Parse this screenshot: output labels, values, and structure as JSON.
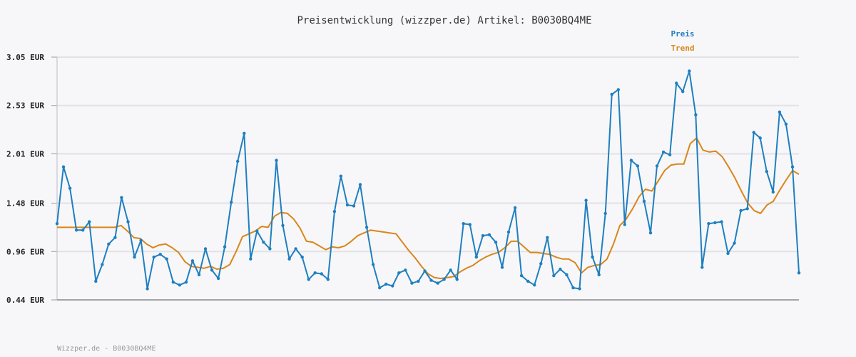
{
  "chart_data": {
    "type": "line",
    "title": "Preisentwicklung (wizzper.de) Artikel: B0030BQ4ME",
    "xlabel": "",
    "ylabel": "",
    "ylim": [
      0.44,
      3.05
    ],
    "yticks": [
      "3.05 EUR",
      "2.53 EUR",
      "2.01 EUR",
      "1.48 EUR",
      "0.96 EUR",
      "0.44 EUR"
    ],
    "ytick_values": [
      3.05,
      2.53,
      2.01,
      1.48,
      0.96,
      0.44
    ],
    "grid": true,
    "legend_position": "top-right",
    "series": [
      {
        "name": "Preis",
        "color": "#1f7fbf",
        "markers": true,
        "values": [
          1.26,
          1.87,
          1.64,
          1.19,
          1.19,
          1.28,
          0.64,
          0.82,
          1.04,
          1.11,
          1.54,
          1.28,
          0.9,
          1.08,
          0.56,
          0.9,
          0.93,
          0.88,
          0.63,
          0.6,
          0.63,
          0.86,
          0.71,
          0.99,
          0.76,
          0.67,
          1.01,
          1.49,
          1.93,
          2.23,
          0.88,
          1.18,
          1.06,
          0.99,
          1.94,
          1.24,
          0.88,
          0.99,
          0.9,
          0.66,
          0.73,
          0.72,
          0.66,
          1.39,
          1.77,
          1.46,
          1.45,
          1.68,
          1.22,
          0.82,
          0.57,
          0.61,
          0.59,
          0.73,
          0.76,
          0.62,
          0.64,
          0.75,
          0.65,
          0.62,
          0.66,
          0.76,
          0.66,
          1.26,
          1.25,
          0.9,
          1.13,
          1.14,
          1.06,
          0.79,
          1.17,
          1.43,
          0.7,
          0.64,
          0.6,
          0.83,
          1.11,
          0.7,
          0.77,
          0.71,
          0.57,
          0.56,
          1.51,
          0.9,
          0.71,
          1.37,
          2.65,
          2.7,
          1.25,
          1.94,
          1.88,
          1.5,
          1.16,
          1.88,
          2.03,
          2.0,
          2.77,
          2.68,
          2.9,
          2.43,
          0.79,
          1.26,
          1.27,
          1.28,
          0.94,
          1.05,
          1.4,
          1.42,
          2.24,
          2.18,
          1.82,
          1.6,
          2.46,
          2.33,
          1.87,
          0.73
        ]
      },
      {
        "name": "Trend",
        "color": "#d9861a",
        "markers": false,
        "values": [
          1.22,
          1.22,
          1.22,
          1.22,
          1.22,
          1.22,
          1.22,
          1.22,
          1.22,
          1.22,
          1.24,
          1.18,
          1.11,
          1.1,
          1.04,
          1.0,
          1.03,
          1.04,
          1.0,
          0.95,
          0.85,
          0.8,
          0.79,
          0.78,
          0.8,
          0.77,
          0.78,
          0.82,
          0.96,
          1.12,
          1.15,
          1.18,
          1.23,
          1.22,
          1.34,
          1.38,
          1.37,
          1.31,
          1.21,
          1.07,
          1.06,
          1.02,
          0.98,
          1.01,
          1.0,
          1.02,
          1.07,
          1.13,
          1.16,
          1.19,
          1.18,
          1.17,
          1.16,
          1.15,
          1.06,
          0.97,
          0.89,
          0.8,
          0.72,
          0.68,
          0.67,
          0.68,
          0.69,
          0.74,
          0.78,
          0.81,
          0.86,
          0.9,
          0.93,
          0.95,
          1.0,
          1.07,
          1.07,
          1.01,
          0.95,
          0.95,
          0.94,
          0.93,
          0.9,
          0.88,
          0.88,
          0.84,
          0.73,
          0.79,
          0.81,
          0.82,
          0.88,
          1.04,
          1.24,
          1.31,
          1.42,
          1.55,
          1.63,
          1.61,
          1.72,
          1.83,
          1.89,
          1.9,
          1.9,
          2.12,
          2.18,
          2.05,
          2.03,
          2.04,
          1.98,
          1.87,
          1.75,
          1.61,
          1.48,
          1.4,
          1.37,
          1.46,
          1.5,
          1.62,
          1.73,
          1.83,
          1.79
        ]
      }
    ]
  },
  "footer": "Wizzper.de - B0030BQ4ME"
}
